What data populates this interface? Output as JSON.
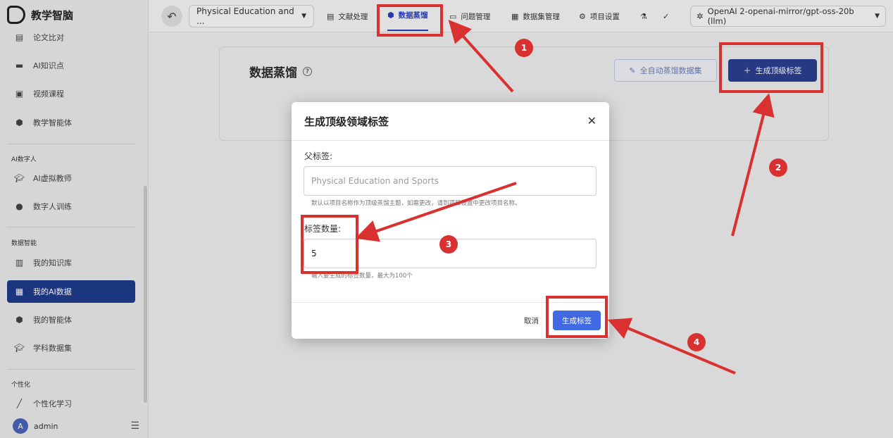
{
  "sidebar": {
    "logo": "教学智脑",
    "items": [
      {
        "label": "论文比对",
        "icon": "document-compare-icon"
      },
      {
        "label": "AI知识点",
        "icon": "clapperboard-icon"
      },
      {
        "label": "视频课程",
        "icon": "video-icon"
      },
      {
        "label": "教学智能体",
        "icon": "cube-icon"
      },
      {
        "label": "AI虚拟教师",
        "icon": "graduation-cap-icon"
      },
      {
        "label": "数字人训练",
        "icon": "person-icon"
      },
      {
        "label": "我的知识库",
        "icon": "book-icon"
      },
      {
        "label": "我的AI数据",
        "icon": "database-icon"
      },
      {
        "label": "我的智能体",
        "icon": "cube-icon"
      },
      {
        "label": "学科数据集",
        "icon": "graduation-cap-icon"
      },
      {
        "label": "个性化学习",
        "icon": "magic-wand-icon"
      }
    ],
    "sections": [
      "AI数字人",
      "数据智能",
      "个性化"
    ],
    "user": "admin",
    "avatar_letter": "A"
  },
  "topbar": {
    "project": "Physical Education and ...",
    "nav": [
      {
        "label": "文献处理"
      },
      {
        "label": "数据蒸馏"
      },
      {
        "label": "问题管理"
      },
      {
        "label": "数据集管理"
      },
      {
        "label": "项目设置"
      }
    ],
    "model": "OpenAI 2-openai-mirror/gpt-oss-20b (llm)"
  },
  "main": {
    "title": "数据蒸馏",
    "auto_button": "全自动蒸馏数据集",
    "generate_top_button": "生成顶级标签"
  },
  "modal": {
    "title": "生成顶级领域标签",
    "parent_label": "父标签:",
    "parent_placeholder": "Physical Education and Sports",
    "parent_help": "默认以项目名称作为顶级蒸馏主题，如需更改，请到项目设置中更改项目名称。",
    "count_label": "标签数量:",
    "count_value": "5",
    "count_help": "输入要生成的标签数量，最大为100个",
    "cancel": "取消",
    "submit": "生成标签"
  },
  "annotations": [
    "1",
    "2",
    "3",
    "4"
  ],
  "colors": {
    "accent": "#2a3fbf",
    "annotation": "#d93030",
    "submit": "#4169e1",
    "active_sidebar": "#1f3a8a"
  }
}
